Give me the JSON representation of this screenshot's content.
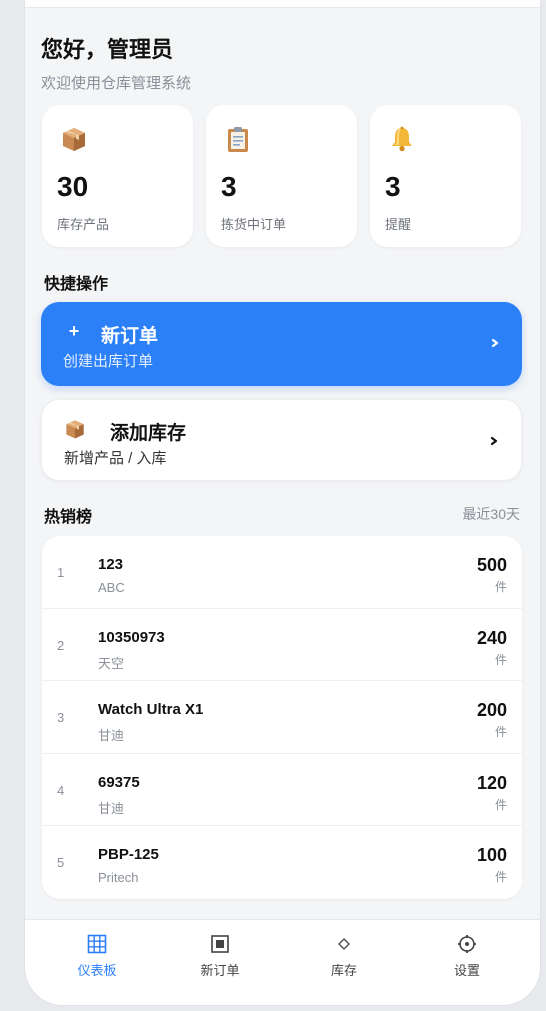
{
  "greeting": {
    "title": "您好，管理员",
    "subtitle": "欢迎使用仓库管理系统"
  },
  "stats": [
    {
      "icon": "package-icon",
      "value": "30",
      "label": "库存产品"
    },
    {
      "icon": "clipboard-icon",
      "value": "3",
      "label": "拣货中订单"
    },
    {
      "icon": "bell-icon",
      "value": "3",
      "label": "提醒"
    }
  ],
  "quick_actions": {
    "title": "快捷操作",
    "new_order": {
      "icon_glyph": "+",
      "title": "新订单",
      "subtitle": "创建出库订单"
    },
    "add_stock": {
      "icon": "package-icon",
      "title": "添加库存",
      "subtitle": "新增产品 / 入库"
    }
  },
  "bestsellers": {
    "title": "热销榜",
    "period": "最近30天",
    "items": [
      {
        "rank": "1",
        "name": "123",
        "brand": "ABC",
        "qty": "500",
        "unit": "件"
      },
      {
        "rank": "2",
        "name": "10350973",
        "brand": "天空",
        "qty": "240",
        "unit": "件"
      },
      {
        "rank": "3",
        "name": "Watch Ultra X1",
        "brand": "甘迪",
        "qty": "200",
        "unit": "件"
      },
      {
        "rank": "4",
        "name": "69375",
        "brand": "甘迪",
        "qty": "120",
        "unit": "件"
      },
      {
        "rank": "5",
        "name": "PBP-125",
        "brand": "Pritech",
        "qty": "100",
        "unit": "件"
      }
    ]
  },
  "nav": {
    "items": [
      {
        "icon": "grid-icon",
        "label": "仪表板",
        "active": true
      },
      {
        "icon": "square-icon",
        "label": "新订单",
        "active": false
      },
      {
        "icon": "diamond-icon",
        "label": "库存",
        "active": false
      },
      {
        "icon": "gear-icon",
        "label": "设置",
        "active": false
      }
    ]
  },
  "colors": {
    "accent": "#2b7ff7",
    "background": "#f4f5f7",
    "card": "#ffffff",
    "muted_text": "#8a8f98"
  }
}
